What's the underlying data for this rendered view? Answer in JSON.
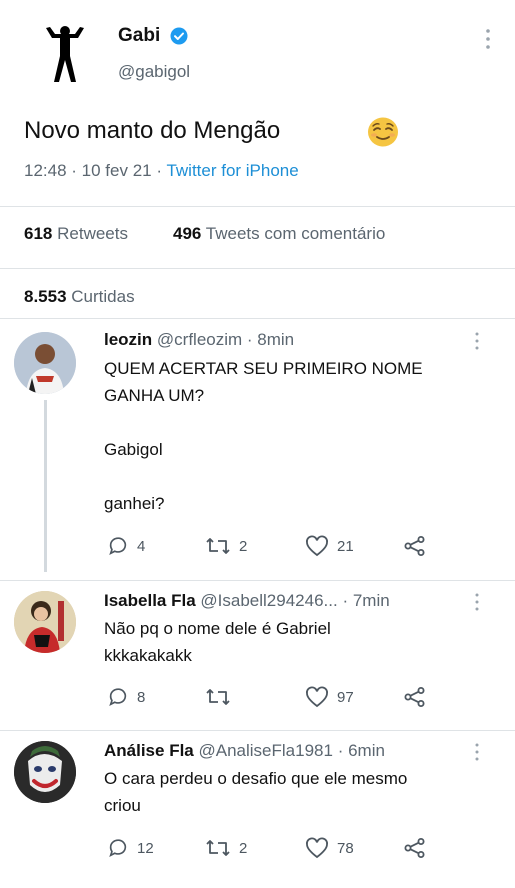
{
  "tweet": {
    "author_name": "Gabi",
    "author_handle": "@gabigol",
    "text": "Novo manto do Mengão",
    "time": "12:48",
    "date": "10 fev 21",
    "source": "Twitter for iPhone",
    "retweets_count": "618",
    "retweets_label": "Retweets",
    "quotes_count": "496",
    "quotes_label": "Tweets com comentário",
    "likes_count": "8.553",
    "likes_label": "Curtidas",
    "icons": [
      "verified-icon",
      "relieved-face-emoji",
      "more-icon"
    ]
  },
  "replies": [
    {
      "name": "leozin",
      "handle": "@crfleozim",
      "time": "· 8min",
      "text": "QUEM ACERTAR SEU PRIMEIRO NOME\nGANHA UM?\n\nGabigol\n\nganhei?",
      "reply_count": "4",
      "retweet_count": "2",
      "like_count": "21"
    },
    {
      "name": "Isabella Fla",
      "handle": "@Isabell294246...",
      "time": "· 7min",
      "text": "Não pq o nome dele é Gabriel\nkkkakakakk",
      "reply_count": "8",
      "retweet_count": "",
      "like_count": "97"
    },
    {
      "name": "Análise Fla",
      "handle": "@AnaliseFla1981",
      "time": "· 6min",
      "text": "O cara perdeu o desafio que ele mesmo\ncriou",
      "reply_count": "12",
      "retweet_count": "2",
      "like_count": "78"
    }
  ],
  "colors": {
    "accent": "#1d8fd6",
    "muted_text": "#5b6670",
    "divider": "#dfe3e6",
    "verified": "#1d9bf0"
  }
}
